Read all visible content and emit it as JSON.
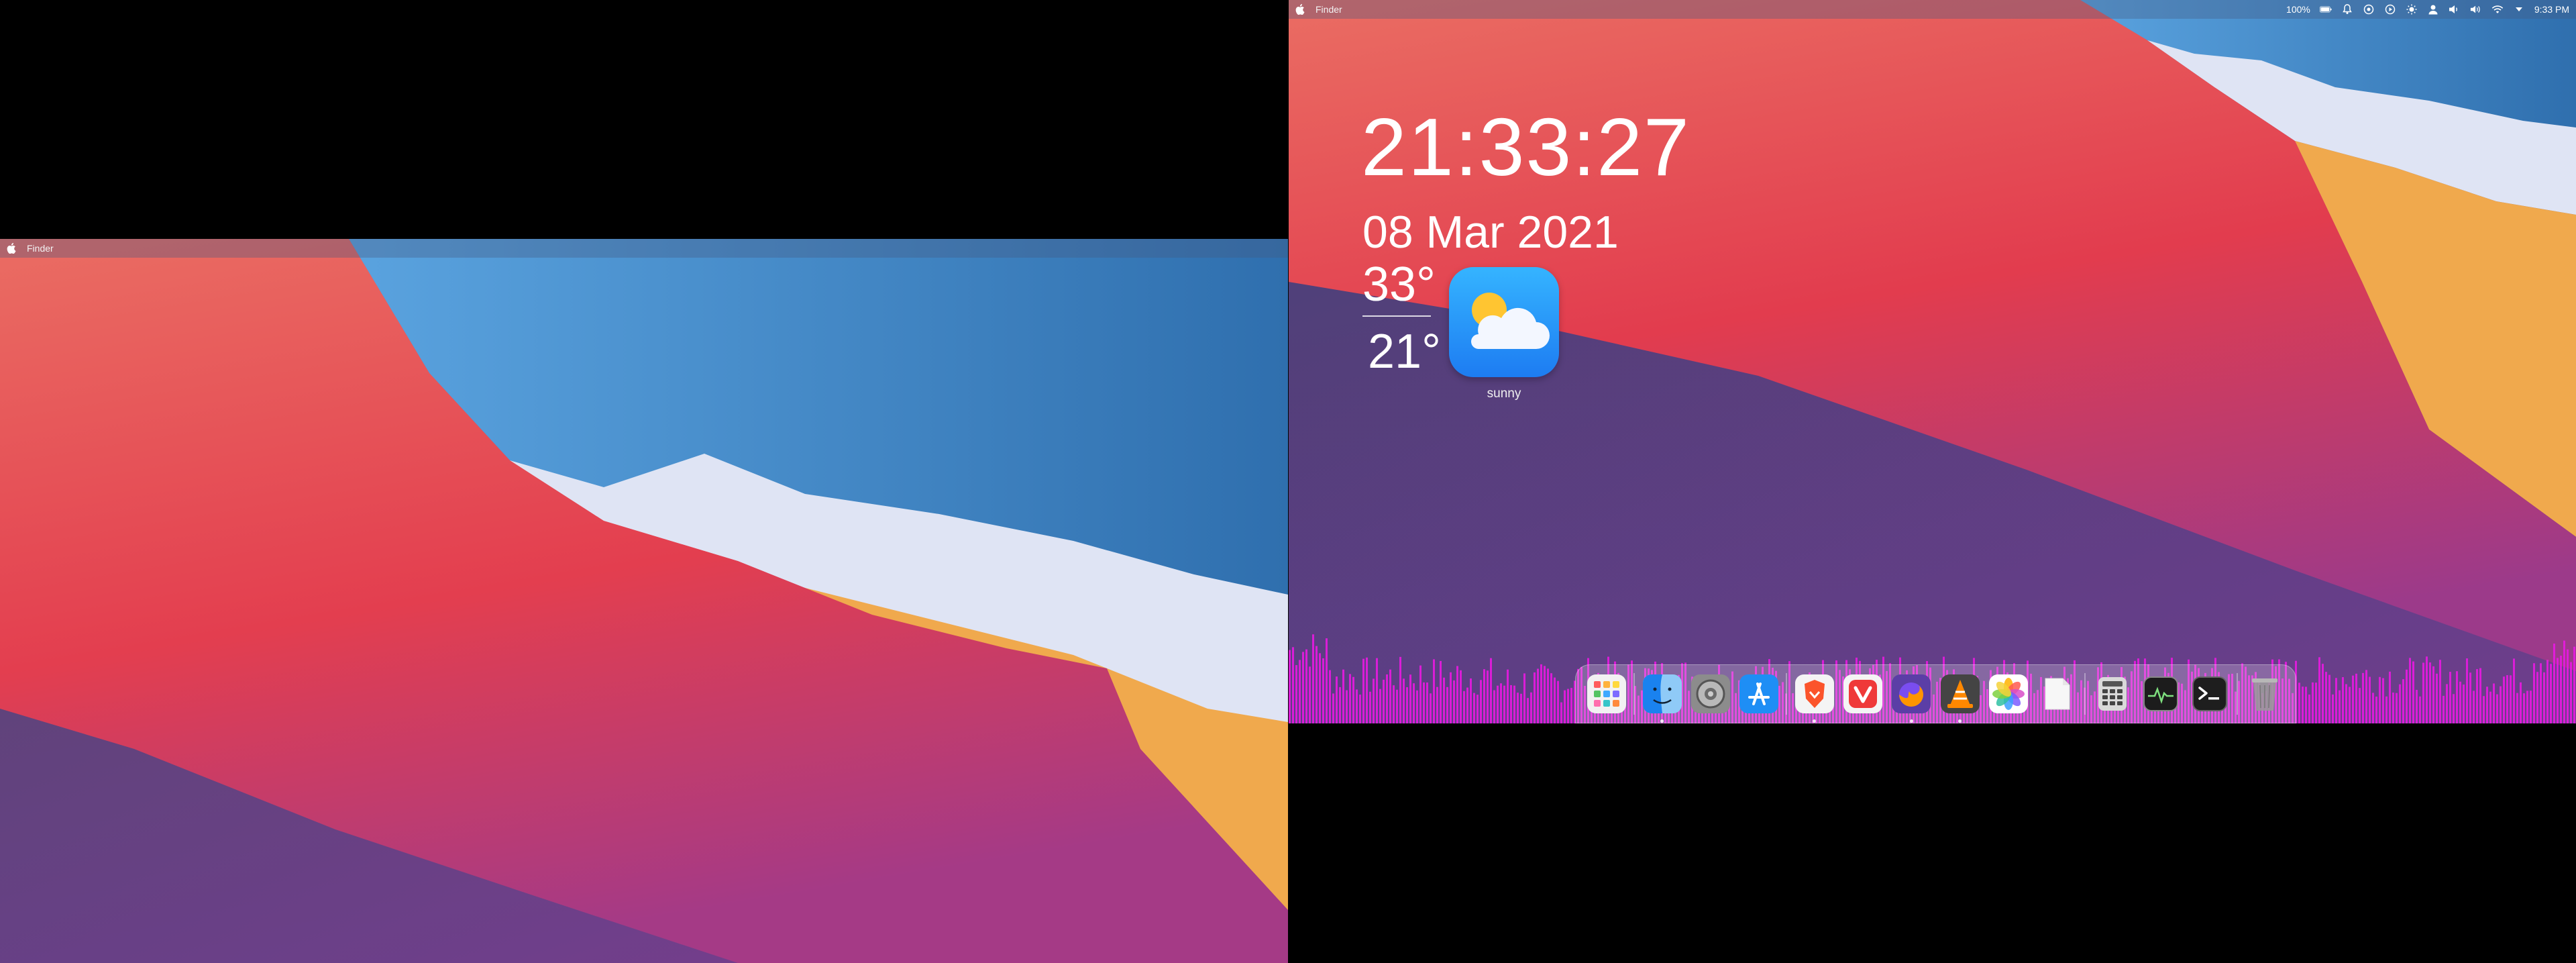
{
  "left_screen": {
    "menubar": {
      "app_name": "Finder",
      "apple_icon": "apple-logo-icon"
    }
  },
  "right_screen": {
    "menubar": {
      "app_name": "Finder",
      "apple_icon": "apple-logo-icon",
      "status": {
        "battery_percent": "100%",
        "time": "9:33 PM",
        "icons": [
          "battery-icon",
          "notification-bell-icon",
          "record-icon",
          "play-circle-icon",
          "brightness-icon",
          "user-icon",
          "volume-icon",
          "sound-icon",
          "wifi-icon",
          "dropdown-arrow-icon"
        ]
      }
    },
    "widgets": {
      "clock": "21:33:27",
      "date": "08 Mar 2021",
      "temp_high": "33°",
      "temp_low": "21°",
      "weather_condition": "sunny",
      "weather_icon": "partly-cloudy-icon"
    },
    "dock": {
      "items": [
        {
          "name": "launchpad-icon",
          "running": false
        },
        {
          "name": "finder-icon",
          "running": true
        },
        {
          "name": "system-preferences-icon",
          "running": false
        },
        {
          "name": "app-store-icon",
          "running": false
        },
        {
          "name": "brave-browser-icon",
          "running": true
        },
        {
          "name": "vivaldi-icon",
          "running": false
        },
        {
          "name": "firefox-icon",
          "running": true
        },
        {
          "name": "vlc-icon",
          "running": true
        },
        {
          "name": "photos-icon",
          "running": false
        },
        {
          "name": "blank-document-icon",
          "running": false
        },
        {
          "name": "calculator-icon",
          "running": false
        },
        {
          "name": "activity-monitor-icon",
          "running": false
        },
        {
          "name": "terminal-icon",
          "running": false
        },
        {
          "name": "trash-icon",
          "running": false
        }
      ]
    },
    "colors": {
      "visualizer": "#e81ae0",
      "accent_blue": "#1d7cf2"
    }
  }
}
